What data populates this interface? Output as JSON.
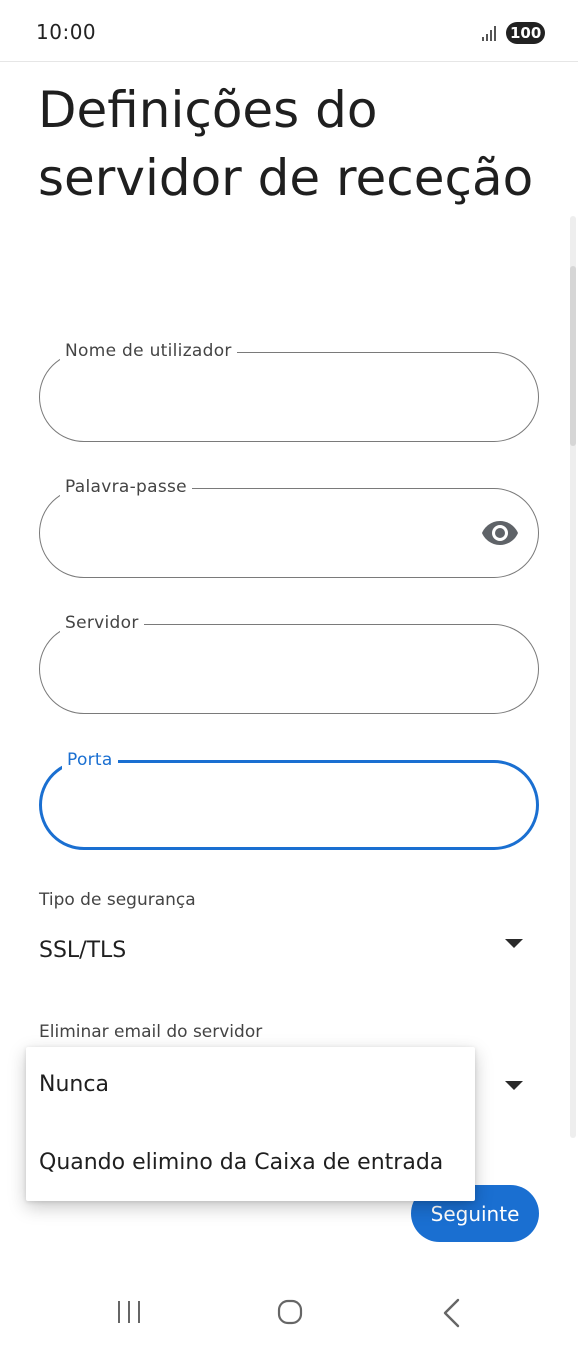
{
  "status_bar": {
    "time": "10:00",
    "battery": "100",
    "signal_icon": "signal-bars-icon"
  },
  "title": "Definições do servidor de receção",
  "fields": {
    "username": {
      "label": "Nome de utilizador",
      "value": ""
    },
    "password": {
      "label": "Palavra-passe",
      "value": "",
      "toggle_icon": "eye-icon"
    },
    "server": {
      "label": "Servidor",
      "value": ""
    },
    "port": {
      "label": "Porta",
      "value": "",
      "focused": true
    }
  },
  "security": {
    "label": "Tipo de segurança",
    "value": "SSL/TLS"
  },
  "delete_email": {
    "label": "Eliminar email do servidor",
    "options": [
      "Nunca",
      "Quando elimino da Caixa de entrada"
    ]
  },
  "next_button": {
    "label": "Seguinte"
  },
  "navigation": {
    "recents_icon": "recents-icon",
    "home_icon": "home-icon",
    "back_icon": "back-icon"
  },
  "colors": {
    "accent": "#1a6fd1",
    "outline": "#7a7a7a",
    "text": "#1f1f1f"
  }
}
